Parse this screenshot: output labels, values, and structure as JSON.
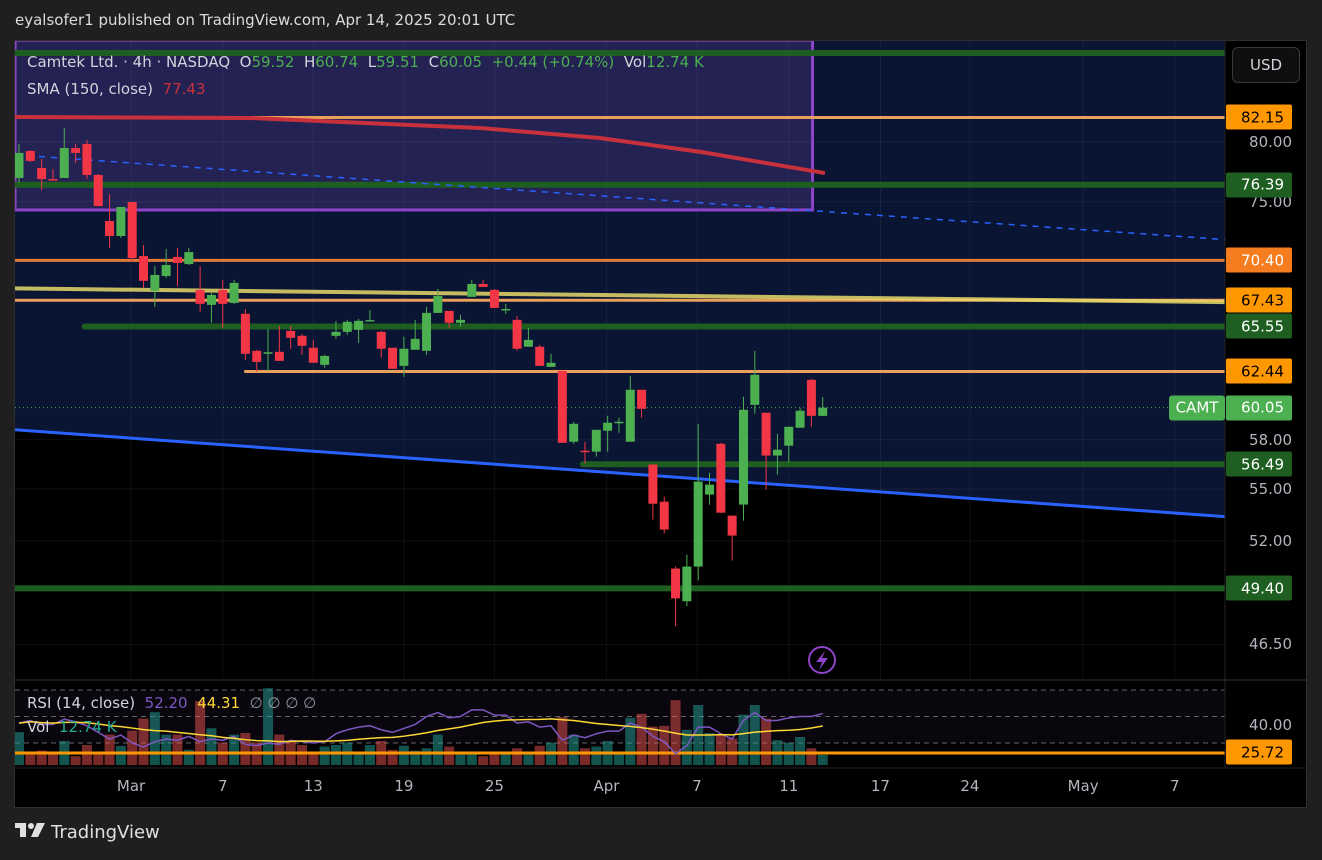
{
  "header": {
    "text": "eyalsofer1 published on TradingView.com, Apr 14, 2025 20:01 UTC"
  },
  "legend": {
    "symbol": "Camtek Ltd. · 4h · NASDAQ",
    "o_label": "O",
    "o": "59.52",
    "h_label": "H",
    "h": "60.74",
    "l_label": "L",
    "l": "59.51",
    "c_label": "C",
    "c": "60.05",
    "change": "+0.44 (+0.74%)",
    "vol_label": "Vol",
    "vol": "12.74 K",
    "sma_label": "SMA (150, close)",
    "sma_value": "77.43",
    "rsi_label": "RSI (14, close)",
    "rsi_value": "52.20",
    "rsi_ma_value": "44.31",
    "rsi_extra": "∅  ∅  ∅  ∅",
    "vol2_label": "Vol",
    "vol2_value": "12.74 K"
  },
  "currency_button": "USD",
  "symbol_tag": "CAMT",
  "footer": {
    "logo_glyph": "17",
    "brand": "TradingView"
  },
  "icons": {
    "lightning": "lightning-icon"
  },
  "colors": {
    "up": "#4caf50",
    "down": "#f23645",
    "sma": "#c8313b",
    "rsi": "#7e57c2",
    "rsi_ma": "#fdd835",
    "trend_blue": "#2962ff",
    "zone": "#8e44c9"
  },
  "chart_data": {
    "type": "candlestick",
    "title": "Camtek Ltd. · 4h · NASDAQ",
    "yscale": "log",
    "ylim": [
      45.5,
      89.3
    ],
    "candles": [
      [
        76.95,
        79.83,
        76.53,
        79.06
      ],
      [
        79.23,
        79.31,
        78.29,
        78.38
      ],
      [
        77.79,
        78.55,
        75.96,
        76.86
      ],
      [
        76.86,
        77.7,
        76.78,
        76.78
      ],
      [
        76.95,
        81.22,
        76.95,
        79.48
      ],
      [
        79.48,
        79.83,
        78.21,
        79.06
      ],
      [
        79.83,
        80.17,
        76.86,
        77.2
      ],
      [
        77.2,
        77.28,
        74.65,
        74.65
      ],
      [
        73.46,
        75.63,
        71.35,
        72.28
      ],
      [
        72.28,
        74.58,
        72.13,
        74.58
      ],
      [
        74.98,
        74.98,
        70.28,
        70.58
      ],
      [
        70.73,
        71.58,
        68.34,
        68.86
      ],
      [
        68.12,
        69.97,
        66.95,
        69.3
      ],
      [
        69.22,
        71.27,
        69.08,
        70.05
      ],
      [
        70.66,
        71.35,
        68.49,
        70.2
      ],
      [
        70.12,
        71.35,
        70.05,
        71.03
      ],
      [
        68.19,
        69.97,
        66.59,
        67.17
      ],
      [
        67.1,
        67.97,
        65.81,
        67.82
      ],
      [
        68.19,
        68.93,
        65.45,
        67.17
      ],
      [
        67.24,
        68.93,
        67.17,
        68.71
      ],
      [
        66.45,
        66.8,
        63.23,
        63.64
      ],
      [
        63.85,
        63.92,
        62.42,
        63.09
      ],
      [
        63.71,
        65.38,
        62.48,
        63.75
      ],
      [
        63.78,
        65.59,
        63.16,
        63.16
      ],
      [
        65.24,
        65.59,
        63.99,
        64.75
      ],
      [
        64.89,
        65.03,
        63.57,
        64.2
      ],
      [
        64.06,
        64.61,
        63.03,
        63.03
      ],
      [
        62.89,
        63.57,
        62.69,
        63.5
      ],
      [
        64.89,
        65.95,
        64.68,
        65.17
      ],
      [
        65.17,
        66.02,
        64.96,
        65.88
      ],
      [
        65.31,
        66.09,
        64.4,
        65.95
      ],
      [
        65.95,
        66.73,
        65.95,
        66.0
      ],
      [
        65.17,
        65.24,
        63.37,
        63.99
      ],
      [
        64.06,
        64.06,
        62.62,
        62.62
      ],
      [
        62.82,
        64.82,
        62.08,
        63.99
      ],
      [
        63.92,
        66.02,
        63.92,
        64.68
      ],
      [
        63.85,
        66.95,
        63.57,
        66.52
      ],
      [
        66.52,
        68.26,
        66.52,
        67.75
      ],
      [
        66.66,
        66.66,
        65.45,
        65.81
      ],
      [
        65.81,
        66.38,
        65.52,
        66.02
      ],
      [
        67.68,
        68.93,
        67.68,
        68.63
      ],
      [
        68.63,
        68.93,
        68.41,
        68.41
      ],
      [
        68.19,
        68.26,
        66.88,
        66.88
      ],
      [
        66.8,
        67.17,
        66.45,
        66.8
      ],
      [
        66.02,
        66.31,
        63.85,
        63.99
      ],
      [
        64.13,
        65.45,
        64.13,
        64.61
      ],
      [
        64.13,
        64.27,
        62.82,
        62.82
      ],
      [
        62.75,
        63.64,
        62.75,
        63.03
      ],
      [
        62.48,
        62.48,
        57.81,
        57.81
      ],
      [
        57.88,
        59.14,
        57.75,
        59.01
      ],
      [
        57.32,
        57.88,
        56.53,
        57.26
      ],
      [
        57.26,
        58.63,
        56.96,
        58.63
      ],
      [
        58.57,
        59.52,
        57.26,
        59.08
      ],
      [
        59.08,
        59.4,
        58.44,
        59.14
      ],
      [
        57.88,
        62.15,
        57.88,
        61.22
      ],
      [
        61.22,
        61.22,
        59.4,
        59.97
      ],
      [
        56.47,
        56.47,
        53.21,
        54.13
      ],
      [
        54.25,
        54.55,
        52.42,
        52.64
      ],
      [
        50.47,
        50.58,
        47.42,
        48.87
      ],
      [
        48.72,
        51.24,
        48.46,
        50.58
      ],
      [
        50.58,
        59.01,
        49.83,
        55.44
      ],
      [
        54.67,
        55.98,
        54.08,
        55.26
      ],
      [
        57.75,
        57.81,
        53.61,
        53.61
      ],
      [
        53.44,
        53.44,
        50.91,
        52.3
      ],
      [
        54.08,
        60.76,
        53.15,
        59.91
      ],
      [
        60.23,
        63.85,
        59.65,
        62.22
      ],
      [
        59.72,
        59.72,
        54.96,
        57.02
      ],
      [
        57.02,
        58.38,
        55.86,
        57.38
      ],
      [
        57.63,
        58.82,
        56.59,
        58.82
      ],
      [
        58.76,
        60.04,
        58.76,
        59.85
      ],
      [
        61.88,
        61.95,
        58.82,
        59.52
      ],
      [
        59.52,
        60.74,
        59.51,
        60.05
      ]
    ],
    "volume_k": [
      41,
      15,
      18,
      16,
      30,
      11,
      25,
      16,
      38,
      24,
      43,
      58,
      66,
      38,
      38,
      19,
      80,
      46,
      28,
      38,
      40,
      28,
      96,
      38,
      29,
      25,
      16,
      23,
      25,
      28,
      16,
      25,
      30,
      19,
      24,
      18,
      21,
      38,
      23,
      13,
      13,
      11,
      13,
      15,
      21,
      13,
      24,
      28,
      60,
      38,
      21,
      23,
      30,
      16,
      59,
      64,
      48,
      49,
      81,
      44,
      75,
      40,
      38,
      33,
      63,
      75,
      58,
      31,
      28,
      35,
      21,
      12.74
    ],
    "rsi": [
      45,
      47,
      44,
      44,
      48,
      46,
      43,
      38,
      33,
      36,
      30,
      27,
      31,
      33,
      32,
      35,
      31,
      33,
      32,
      35,
      29,
      28,
      30,
      29,
      32,
      31,
      30,
      31,
      37,
      40,
      42,
      43,
      40,
      38,
      41,
      44,
      50,
      53,
      49,
      50,
      55,
      55,
      51,
      51,
      45,
      46,
      42,
      43,
      32,
      36,
      34,
      37,
      39,
      39,
      45,
      42,
      35,
      31,
      22,
      28,
      42,
      42,
      37,
      33,
      47,
      53,
      47,
      47,
      49,
      50,
      50,
      52.2
    ],
    "rsi_bands": [
      70,
      50,
      30
    ],
    "sma_150": [
      {
        "bar": -0.35,
        "price": 82.19
      },
      {
        "bar": 20.4,
        "price": 82.1
      },
      {
        "bar": 40.7,
        "price": 81.22
      },
      {
        "bar": 51.3,
        "price": 80.35
      },
      {
        "bar": 60.2,
        "price": 79.15
      },
      {
        "bar": 71.2,
        "price": 77.36
      }
    ],
    "levels": [
      {
        "price": 88.07,
        "color": "#1e5e20",
        "width": 6,
        "from_bar": -1
      },
      {
        "price": 82.15,
        "color": "#e8a05a",
        "width": 3,
        "from_bar": -1
      },
      {
        "price": 76.39,
        "color": "#1e5e20",
        "width": 6,
        "from_bar": -1
      },
      {
        "price": 70.4,
        "color": "#e07a3a",
        "width": 3,
        "from_bar": -1
      },
      {
        "price": 67.43,
        "color": "#e8a05a",
        "width": 3,
        "from_bar": -1
      },
      {
        "price": 65.55,
        "color": "#1e5e20",
        "width": 6,
        "from_bar": 5.8
      },
      {
        "price": 62.44,
        "color": "#e8a05a",
        "width": 3,
        "from_bar": 20
      },
      {
        "price": 56.49,
        "color": "#1e5e20",
        "width": 6,
        "from_bar": 49.8
      },
      {
        "price": 49.4,
        "color": "#1e5e20",
        "width": 6,
        "from_bar": -1
      }
    ],
    "trendlines": [
      {
        "name": "support-trendline",
        "from": [
          -0.35,
          58.63
        ],
        "to": [
          106.5,
          53.38
        ],
        "color": "#2962ff",
        "dashed": false
      },
      {
        "name": "dashed-trendline",
        "from": [
          -0.35,
          78.9
        ],
        "to": [
          106.5,
          72.0
        ],
        "color": "#2962ff",
        "dashed": true
      },
      {
        "name": "yellow-trendline",
        "from": [
          -0.35,
          68.3
        ],
        "to": [
          106.5,
          67.3
        ],
        "color": "#e6d96a",
        "dashed": false
      }
    ],
    "zone": {
      "from_bar": -0.35,
      "to_bar": 70.1,
      "top": 89.3,
      "bottom": 74.34
    },
    "current_price": 60.05,
    "price_tags": [
      {
        "text": "82.15",
        "price": 82.15,
        "bg": "#ff9800",
        "fg": "#000"
      },
      {
        "text": "76.39",
        "price": 76.39,
        "bg": "#1e5e20",
        "fg": "#fff"
      },
      {
        "text": "70.40",
        "price": 70.4,
        "bg": "#f57c1f",
        "fg": "#fff"
      },
      {
        "text": "67.43",
        "price": 67.43,
        "bg": "#ff9800",
        "fg": "#000"
      },
      {
        "text": "65.55",
        "price": 65.55,
        "bg": "#1e5e20",
        "fg": "#fff"
      },
      {
        "text": "62.44",
        "price": 62.44,
        "bg": "#ff9800",
        "fg": "#000"
      },
      {
        "text": "60.05",
        "price": 60.05,
        "bg": "#4caf50",
        "fg": "#fff"
      },
      {
        "text": "56.49",
        "price": 56.49,
        "bg": "#1e5e20",
        "fg": "#fff"
      },
      {
        "text": "49.40",
        "price": 49.4,
        "bg": "#1e5e20",
        "fg": "#fff"
      }
    ],
    "y_ticks": [
      "80.00",
      "75.00",
      "58.00",
      "55.00",
      "52.00",
      "46.50"
    ],
    "rsi_axis": {
      "tick": "40.00",
      "tag": "25.72"
    },
    "x_ticks": [
      {
        "label": "Mar",
        "bar": 9.9
      },
      {
        "label": "7",
        "bar": 18
      },
      {
        "label": "13",
        "bar": 26
      },
      {
        "label": "19",
        "bar": 34
      },
      {
        "label": "25",
        "bar": 42
      },
      {
        "label": "Apr",
        "bar": 51.9
      },
      {
        "label": "7",
        "bar": 59.9
      },
      {
        "label": "11",
        "bar": 68
      },
      {
        "label": "17",
        "bar": 76.1
      },
      {
        "label": "24",
        "bar": 84
      },
      {
        "label": "May",
        "bar": 94
      },
      {
        "label": "7",
        "bar": 102.1
      }
    ]
  }
}
